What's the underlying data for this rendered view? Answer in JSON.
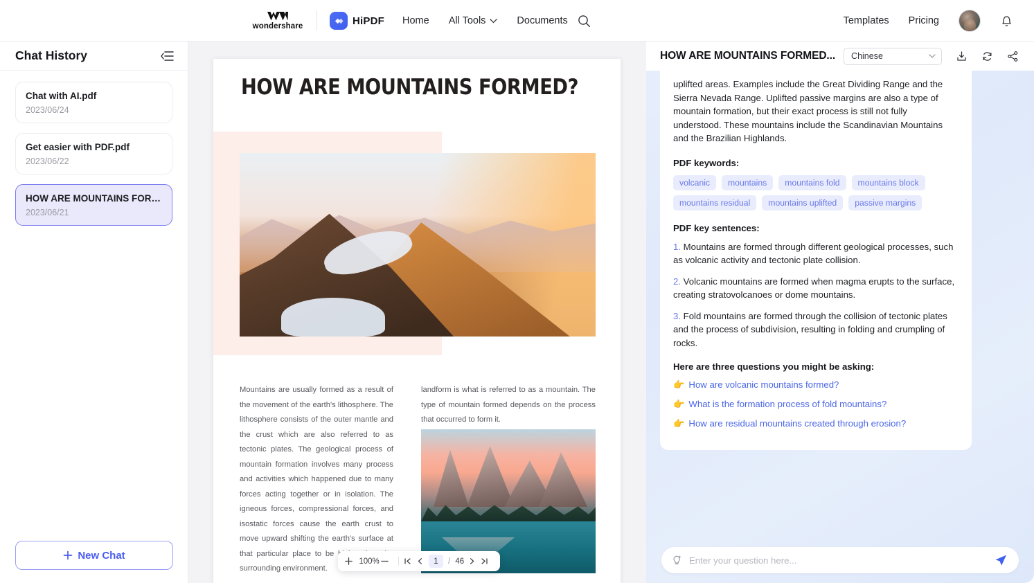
{
  "topnav": {
    "brand_name": "wondershare",
    "product_name": "HiPDF",
    "links": [
      {
        "label": "Home",
        "caret": false
      },
      {
        "label": "All Tools",
        "caret": true
      },
      {
        "label": "Documents",
        "caret": false
      }
    ],
    "search_icon": "search-icon",
    "right_links": [
      {
        "label": "Templates"
      },
      {
        "label": "Pricing"
      }
    ],
    "bell_icon": "bell-icon",
    "avatar_label": "user-avatar"
  },
  "sidebar": {
    "title": "Chat History",
    "collapse_icon": "collapse-panel-icon",
    "items": [
      {
        "name": "Chat with AI.pdf",
        "date": "2023/06/24",
        "active": false
      },
      {
        "name": "Get easier with PDF.pdf",
        "date": "2023/06/22",
        "active": false
      },
      {
        "name": "HOW ARE MOUNTAINS FORME...",
        "date": "2023/06/21",
        "active": true
      }
    ],
    "new_chat_label": "New Chat",
    "new_chat_icon": "plus-icon"
  },
  "viewer": {
    "document_title": "HOW ARE MOUNTAINS FORMED?",
    "body_left": "Mountains are usually formed as a result of the movement of the earth's lithosphere. The lithosphere consists of the outer mantle and the crust which are also referred to as tectonic plates. The geological process of mountain formation involves many process and activities which happened due to many forces acting together or in isolation. The igneous forces, compressional forces, and isostatic forces cause the earth crust to move upward shifting the earth's surface at that particular place to be higher than the surrounding environment.",
    "body_right": "landform is what is referred to as a mountain. The type of mountain formed depends on the process that occurred to form it.",
    "toolbar": {
      "zoom_in_icon": "plus-icon",
      "zoom_level": "100%",
      "zoom_out_icon": "minus-icon",
      "first_page_icon": "first-page-icon",
      "prev_page_icon": "prev-page-icon",
      "current_page": "1",
      "separator": "/",
      "total_pages": "46",
      "next_page_icon": "next-page-icon",
      "last_page_icon": "last-page-icon"
    }
  },
  "right_panel": {
    "title": "HOW ARE MOUNTAINS FORMED...",
    "language_selected": "Chinese",
    "language_caret_icon": "chevron-down-icon",
    "download_icon": "download-icon",
    "refresh_icon": "refresh-icon",
    "share_icon": "share-icon",
    "summary_paragraph": "uplifted areas. Examples include the Great Dividing Range and the Sierra Nevada Range. Uplifted passive margins are also a type of mountain formation, but their exact process is still not fully understood. These mountains include the Scandinavian Mountains and the Brazilian Highlands.",
    "keywords_heading": "PDF keywords:",
    "keywords": [
      "volcanic",
      "mountains",
      "mountains fold",
      "mountains block",
      "mountains residual",
      "mountains uplifted",
      "passive margins"
    ],
    "sentences_heading": "PDF key sentences:",
    "sentences": [
      {
        "num": "1.",
        "text": "Mountains are formed through different geological processes, such as volcanic activity and tectonic plate collision."
      },
      {
        "num": "2.",
        "text": "Volcanic mountains are formed when magma erupts to the surface, creating stratovolcanoes or dome mountains."
      },
      {
        "num": "3.",
        "text": "Fold mountains are formed through the collision of tectonic plates and the process of subdivision, resulting in folding and crumpling of rocks."
      }
    ],
    "questions_heading": "Here are three questions you might be asking:",
    "questions": [
      {
        "icon": "pointing-hand-icon",
        "text": "How are volcanic mountains formed?"
      },
      {
        "icon": "pointing-hand-icon",
        "text": "What is the formation process of fold mountains?"
      },
      {
        "icon": "pointing-hand-icon",
        "text": "How are residual mountains created through erosion?"
      }
    ],
    "ask_placeholder": "Enter your question here...",
    "ask_value": "",
    "ask_left_icon": "ai-bulb-icon",
    "send_icon": "send-icon"
  },
  "colors": {
    "accent": "#4a5cf0",
    "tag_bg": "#e9ecfd",
    "tag_text": "#6a7ae8",
    "link": "#4a66e8",
    "hand": "#f7a52b",
    "panel_bg": "#e3ecfb"
  }
}
